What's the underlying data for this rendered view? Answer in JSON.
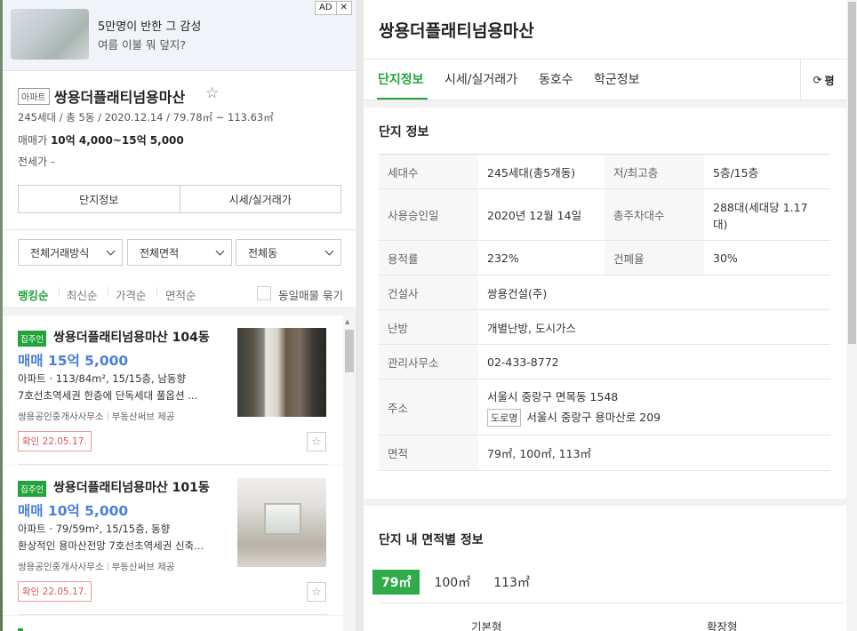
{
  "ad": {
    "title": "5만명이 반한 그 감성",
    "subtitle": "여름 이불 뭐 덮지?",
    "tag": "AD",
    "close": "✕"
  },
  "complex": {
    "type_badge": "아파트",
    "name": "쌍용더플래티넘용마산",
    "star": "☆",
    "meta": "245세대 / 총 5동 / 2020.12.14 / 79.78㎡ ~ 113.63㎡",
    "sale_label": "매매가",
    "sale_value": "10억 4,000~15억 5,000",
    "rent_label": "전세가",
    "rent_value": "-",
    "tabs": [
      "단지정보",
      "시세/실거래가"
    ]
  },
  "filters": {
    "trade": "전체거래방식",
    "area": "전체면적",
    "dong": "전체동"
  },
  "sort": {
    "options": [
      "랭킹순",
      "최신순",
      "가격순",
      "면적순"
    ],
    "active_index": 0,
    "checkbox_label": "동일매물 묶기",
    "accent": "#22a43b"
  },
  "listings": [
    {
      "badge": "집주인",
      "title": "쌍용더플래티넘용마산 104동",
      "price": "매매 15억 5,000",
      "spec": "아파트 · 113/84m², 15/15층, 남동향",
      "desc": "7호선초역세권 한층에 단독세대 풀옵션 ...",
      "agent": "쌍용공인중개사사무소",
      "provider": "부동산써브 제공",
      "confirm": "확인 22.05.17.",
      "fav": "☆"
    },
    {
      "badge": "집주인",
      "title": "쌍용더플래티넘용마산 101동",
      "price": "매매 10억 5,000",
      "spec": "아파트 · 79/59m², 15/15층, 동향",
      "desc": "환상적인 용마산전망 7호선초역세권 신축...",
      "agent": "쌍용공인중개사사무소",
      "provider": "부동산써브 제공",
      "confirm": "확인 22.05.17.",
      "fav": "☆"
    }
  ],
  "right": {
    "title": "쌍용더플래티넘용마산",
    "tabs": [
      "단지정보",
      "시세/실거래가",
      "동호수",
      "학군정보"
    ],
    "active_tab": 0,
    "refresh_label": "평",
    "refresh_icon": "⟳",
    "info_title": "단지 정보",
    "info": {
      "households_k": "세대수",
      "households_v": "245세대(총5개동)",
      "floors_k": "저/최고층",
      "floors_v": "5층/15층",
      "approval_k": "사용승인일",
      "approval_v": "2020년 12월 14일",
      "parking_k": "총주차대수",
      "parking_v": "288대(세대당 1.17대)",
      "far_k": "용적률",
      "far_v": "232%",
      "bcr_k": "건폐율",
      "bcr_v": "30%",
      "builder_k": "건설사",
      "builder_v": "쌍용건설(주)",
      "heating_k": "난방",
      "heating_v": "개별난방, 도시가스",
      "office_k": "관리사무소",
      "office_v": "02-433-8772",
      "address_k": "주소",
      "address_v": "서울시 중랑구 면목동 1548",
      "road_badge": "도로명",
      "road_v": "서울시 중랑구 용마산로 209",
      "area_k": "면적",
      "area_v": "79㎡, 100㎡, 113㎡"
    },
    "area_section_title": "단지 내 면적별 정보",
    "area_tabs": [
      "79㎡",
      "100㎡",
      "113㎡"
    ],
    "area_active": 0,
    "area_cols": [
      "기본형",
      "확장형"
    ]
  }
}
